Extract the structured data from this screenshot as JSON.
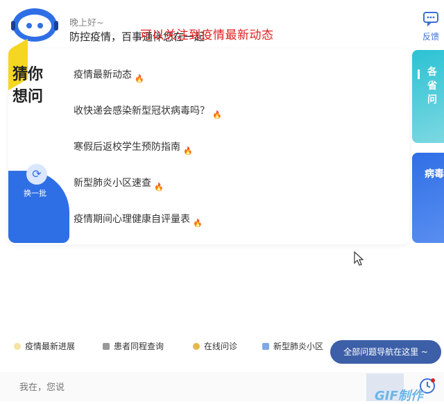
{
  "header": {
    "greeting": "晚上好~",
    "subtitle": "防控疫情，百事通伴您在一起",
    "overlay_caption": "可以关注到疫情最新动态",
    "feedback_label": "反馈"
  },
  "guess": {
    "title": "猜你想问",
    "refresh_label": "换一批",
    "questions": [
      "疫情最新动态",
      "收快递会感染新型冠状病毒吗？",
      "寒假后返校学生预防指南",
      "新型肺炎小区速查",
      "疫情期间心理健康自评量表"
    ]
  },
  "side_cards": {
    "card1_text": "各省问",
    "card2_text": "病毒"
  },
  "shortcuts": {
    "items": [
      "疫情最新进展",
      "患者同程查询",
      "在线问诊",
      "新型肺炎小区"
    ],
    "nav_tip": "全部问题导航在这里 ~"
  },
  "input": {
    "placeholder": "我在，您说"
  },
  "watermark": "GIF制作",
  "colors": {
    "accent_blue": "#2f6fe6",
    "overlay_red": "#e02020",
    "fire": "#ff5a4a",
    "yellow": "#f5d622",
    "teal": "#2bc2d4"
  }
}
